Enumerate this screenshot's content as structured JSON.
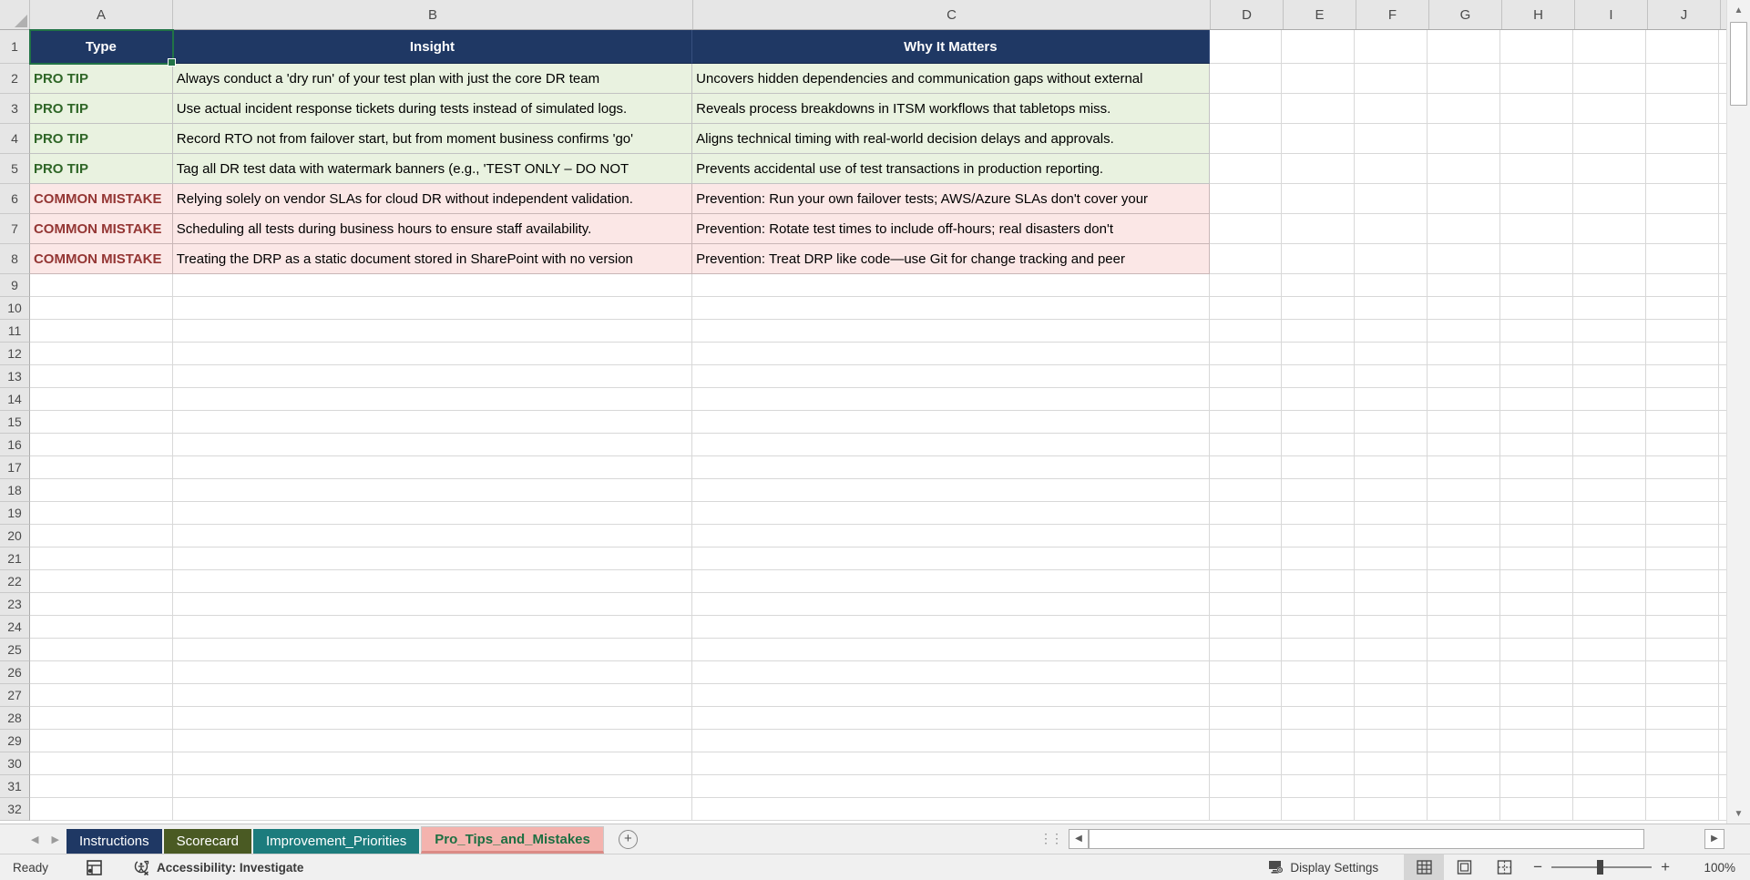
{
  "grid": {
    "column_letters": [
      "A",
      "B",
      "C",
      "D",
      "E",
      "F",
      "G",
      "H",
      "I",
      "J"
    ],
    "total_rows": 32,
    "active_cell": "A1",
    "header_row": {
      "type": "Type",
      "insight": "Insight",
      "why": "Why It Matters"
    },
    "data_rows": [
      {
        "kind": "tip",
        "type": "PRO TIP",
        "insight": "Always conduct a 'dry run' of your test plan with just the core DR team",
        "why": "Uncovers hidden dependencies and communication gaps without external"
      },
      {
        "kind": "tip",
        "type": "PRO TIP",
        "insight": "Use actual incident response tickets during tests instead of simulated logs.",
        "why": "Reveals process breakdowns in ITSM workflows that tabletops miss."
      },
      {
        "kind": "tip",
        "type": "PRO TIP",
        "insight": "Record RTO not from failover start, but from moment business confirms 'go'",
        "why": "Aligns technical timing with real-world decision delays and approvals."
      },
      {
        "kind": "tip",
        "type": "PRO TIP",
        "insight": "Tag all DR test data with watermark banners (e.g., 'TEST ONLY – DO NOT",
        "why": "Prevents accidental use of test transactions in production reporting."
      },
      {
        "kind": "mistake",
        "type": "COMMON MISTAKE",
        "insight": "Relying solely on vendor SLAs for cloud DR without independent validation.",
        "why": "Prevention: Run your own failover tests; AWS/Azure SLAs don't cover your"
      },
      {
        "kind": "mistake",
        "type": "COMMON MISTAKE",
        "insight": "Scheduling all tests during business hours to ensure staff availability.",
        "why": "Prevention: Rotate test times to include off-hours; real disasters don't"
      },
      {
        "kind": "mistake",
        "type": "COMMON MISTAKE",
        "insight": "Treating the DRP as a static document stored in SharePoint with no version",
        "why": "Prevention: Treat DRP like code—use Git for change tracking and peer"
      }
    ]
  },
  "sheet_tabs": {
    "tabs": [
      {
        "label": "Instructions",
        "active": false
      },
      {
        "label": "Scorecard",
        "active": false
      },
      {
        "label": "Improvement_Priorities",
        "active": false
      },
      {
        "label": "Pro_Tips_and_Mistakes",
        "active": true
      }
    ],
    "add_sheet_label": "+"
  },
  "status_bar": {
    "mode": "Ready",
    "accessibility": "Accessibility: Investigate",
    "display_settings": "Display Settings",
    "zoom_level": "100%"
  },
  "colors": {
    "table_header_fill": "#1F3864",
    "tip_fill": "#E9F2E0",
    "tip_text": "#2F6627",
    "mistake_fill": "#FBE7E6",
    "mistake_text": "#943634",
    "selection_green": "#217346",
    "tab_instructions": "#1F3864",
    "tab_scorecard": "#4A5A23",
    "tab_improvement_priorities": "#1C7C7D",
    "tab_active_fill": "#F4B3AE",
    "tab_active_text": "#1D6F42"
  }
}
